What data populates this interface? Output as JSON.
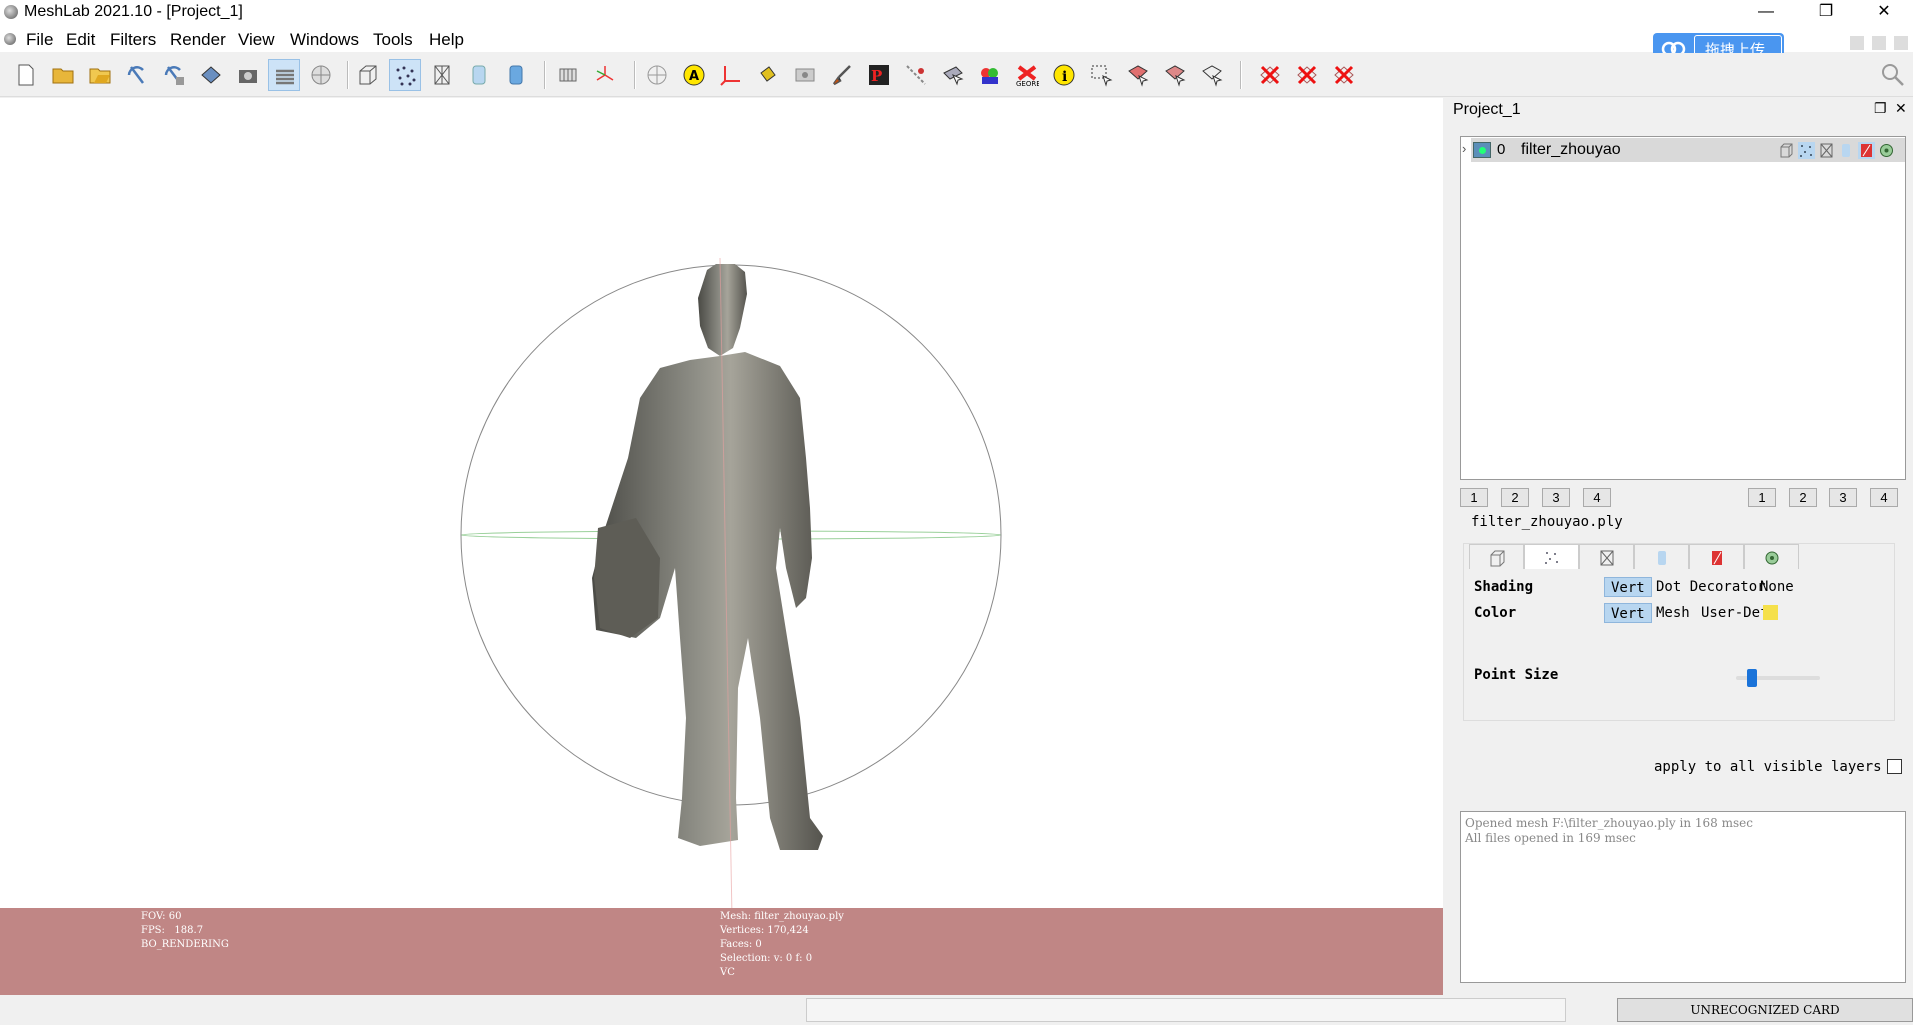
{
  "window": {
    "title": "MeshLab 2021.10 - [Project_1]",
    "controls": [
      "—",
      "❐",
      "✕"
    ]
  },
  "menu": [
    "File",
    "Edit",
    "Filters",
    "Render",
    "View",
    "Windows",
    "Tools",
    "Help"
  ],
  "upload": {
    "label": "拖拽上传"
  },
  "viewport": {
    "info_left": [
      "FOV: 60",
      "FPS:   188.7",
      "BO_RENDERING"
    ],
    "info_right": [
      "Mesh: filter_zhouyao.ply",
      "Vertices: 170,424",
      "Faces: 0",
      "Selection: v: 0 f: 0",
      "VC"
    ]
  },
  "status": {
    "card": "UNRECOGNIZED CARD"
  },
  "panel": {
    "title": "Project_1",
    "float_btn": "❐",
    "close_btn": "✕",
    "layer": {
      "index": "0",
      "name": "filter_zhouyao"
    },
    "left_numbers": [
      "1",
      "2",
      "3",
      "4"
    ],
    "right_numbers": [
      "1",
      "2",
      "3",
      "4"
    ],
    "file_label": "filter_zhouyao.ply",
    "shading": {
      "label": "Shading",
      "options": [
        "Vert",
        "Dot Decorator",
        "None"
      ],
      "selected": "Vert"
    },
    "color": {
      "label": "Color",
      "options": [
        "Vert",
        "Mesh",
        "User-Def"
      ],
      "selected": "Vert",
      "user_color": "#f5e04a"
    },
    "point_size": {
      "label": "Point Size",
      "value_fraction": 0.15
    },
    "apply_label": "apply to all visible layers",
    "log": [
      "Opened mesh F:\\filter_zhouyao.ply in 168 msec",
      "All files opened in 169 msec"
    ]
  },
  "colors": {
    "info_bar": "#c08685",
    "accent": "#4a96f0",
    "selection": "#b8d6f0"
  }
}
